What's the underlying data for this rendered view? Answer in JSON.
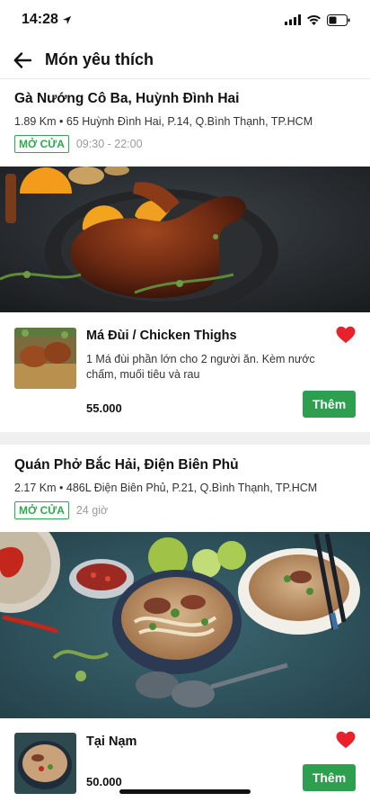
{
  "status_bar": {
    "time": "14:28"
  },
  "header": {
    "title": "Món yêu thích"
  },
  "stores": [
    {
      "name": "Gà Nướng Cô Ba, Huỳnh Đình Hai",
      "info": "1.89 Km • 65 Huỳnh Đình Hai, P.14, Q.Bình Thạnh, TP.HCM",
      "status": "MỞ CỬA",
      "hours": "09:30 - 22:00",
      "dish": {
        "name": "Má Đùi / Chicken Thighs",
        "description": "1 Má đùi phần lớn cho 2 người ăn. Kèm nước chấm, muối tiêu và rau",
        "price": "55.000",
        "add_label": "Thêm"
      }
    },
    {
      "name": "Quán Phở Bắc Hải, Điện Biên Phủ",
      "info": "2.17 Km • 486L Điện Biên Phủ, P.21, Q.Bình Thạnh, TP.HCM",
      "status": "MỞ CỬA",
      "hours": "24 giờ",
      "dish": {
        "name": "Tại Nạm",
        "description": "",
        "price": "50.000",
        "add_label": "Thêm"
      }
    }
  ],
  "colors": {
    "accent_green": "#2e9e4f",
    "heart_red": "#e8212b"
  }
}
